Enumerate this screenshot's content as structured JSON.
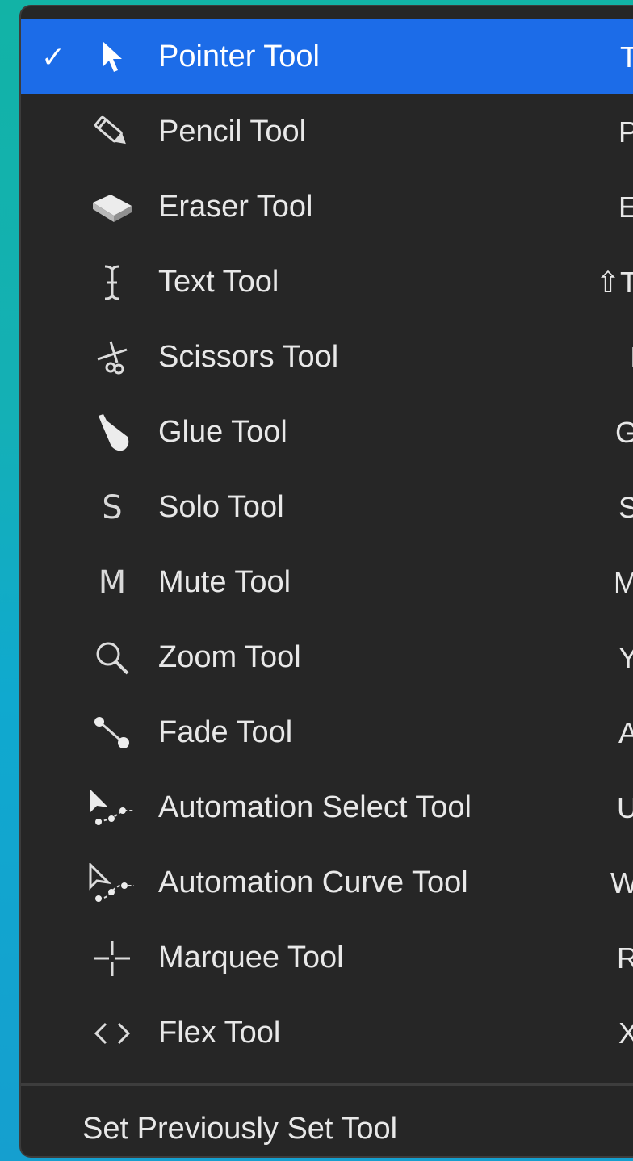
{
  "menu": {
    "items": [
      {
        "label": "Pointer Tool",
        "shortcut": "T",
        "checked": true,
        "check": "✓",
        "icon": "pointer-icon"
      },
      {
        "label": "Pencil Tool",
        "shortcut": "P",
        "icon": "pencil-icon"
      },
      {
        "label": "Eraser Tool",
        "shortcut": "E",
        "icon": "eraser-icon"
      },
      {
        "label": "Text Tool",
        "shortcut": "⇧T",
        "icon": "text-cursor-icon"
      },
      {
        "label": "Scissors Tool",
        "shortcut": "I",
        "icon": "scissors-icon"
      },
      {
        "label": "Glue Tool",
        "shortcut": "G",
        "icon": "glue-icon"
      },
      {
        "label": "Solo Tool",
        "shortcut": "S",
        "icon": "solo-icon",
        "glyph": "S"
      },
      {
        "label": "Mute Tool",
        "shortcut": "M",
        "icon": "mute-icon",
        "glyph": "M"
      },
      {
        "label": "Zoom Tool",
        "shortcut": "Y",
        "icon": "zoom-icon"
      },
      {
        "label": "Fade Tool",
        "shortcut": "A",
        "icon": "fade-icon"
      },
      {
        "label": "Automation Select Tool",
        "shortcut": "U",
        "icon": "automation-select-icon"
      },
      {
        "label": "Automation Curve Tool",
        "shortcut": "W",
        "icon": "automation-curve-icon"
      },
      {
        "label": "Marquee Tool",
        "shortcut": "R",
        "icon": "marquee-icon"
      },
      {
        "label": "Flex Tool",
        "shortcut": "X",
        "icon": "flex-icon"
      }
    ],
    "footer_label": "Set Previously Set Tool"
  },
  "colors": {
    "menu_background": "#262626",
    "highlight": "#1c6ce8",
    "text": "#e8e8e8"
  }
}
